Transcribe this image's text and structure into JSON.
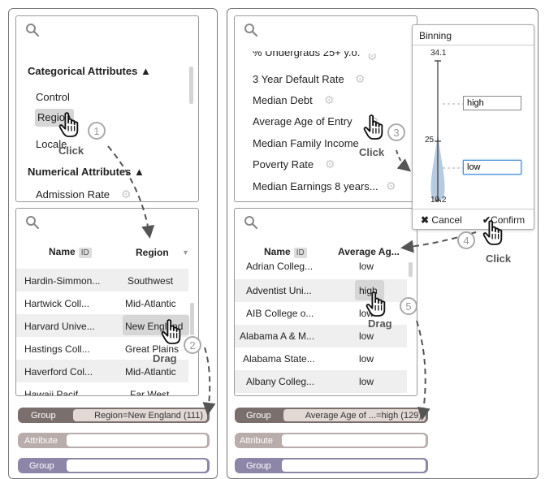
{
  "left": {
    "attr_panel": {
      "categorical_header": "Categorical Attributes",
      "categorical_items": [
        "Control",
        "Region",
        "Locale"
      ],
      "numerical_header": "Numerical Attributes",
      "numerical_items": [
        "Admission Rate"
      ]
    },
    "table": {
      "col_name": "Name",
      "col_badge": "ID",
      "col_value": "Region",
      "rows": [
        {
          "name": "Hardin-Simmon...",
          "value": "Southwest"
        },
        {
          "name": "Hartwick Coll...",
          "value": "Mid-Atlantic"
        },
        {
          "name": "Harvard Unive...",
          "value": "New England"
        },
        {
          "name": "Hastings Coll...",
          "value": "Great Plains"
        },
        {
          "name": "Haverford Col...",
          "value": "Mid-Atlantic"
        },
        {
          "name": "Hawaii Pacif...",
          "value": "Far West"
        }
      ]
    },
    "bars": [
      {
        "label": "Group",
        "value": "Region=New England (111)",
        "color": "#7a6f6d"
      },
      {
        "label": "Attribute",
        "value": "",
        "color": "#b8adab"
      },
      {
        "label": "Group",
        "value": "",
        "color": "#8e86a8"
      }
    ]
  },
  "right": {
    "attr_panel": {
      "items": [
        "% Undergrads 25+ y.o.",
        "3 Year Default Rate",
        "Median Debt",
        "Average Age of Entry",
        "Median Family Income",
        "Poverty Rate",
        "Median Earnings 8 years..."
      ]
    },
    "table": {
      "col_name": "Name",
      "col_badge": "ID",
      "col_value": "Average Ag...",
      "rows": [
        {
          "name": "Adrian Colleg...",
          "value": "low"
        },
        {
          "name": "Adventist Uni...",
          "value": "high"
        },
        {
          "name": "AIB College o...",
          "value": "low"
        },
        {
          "name": "Alabama A & M...",
          "value": "low"
        },
        {
          "name": "Alabama State...",
          "value": "low"
        },
        {
          "name": "Albany Colleg...",
          "value": "low"
        }
      ]
    },
    "bars": [
      {
        "label": "Group",
        "value": "Average Age of ...=high (129)",
        "color": "#7a6f6d"
      },
      {
        "label": "Attribute",
        "value": "",
        "color": "#b8adab"
      },
      {
        "label": "Group",
        "value": "",
        "color": "#8e86a8"
      }
    ]
  },
  "binning": {
    "title": "Binning",
    "max": "34.1",
    "mid": "25",
    "min": "19.2",
    "high_label": "high",
    "low_label": "low",
    "cancel": "Cancel",
    "confirm": "Confirm"
  },
  "annotations": {
    "steps": [
      "1",
      "2",
      "3",
      "4",
      "5"
    ],
    "click": "Click",
    "drag": "Drag"
  },
  "colors": {
    "group_bar": "#7a6f6d",
    "attribute_bar": "#b8adab",
    "group_bar_2": "#8e86a8",
    "violin": "#b6cbe0"
  }
}
